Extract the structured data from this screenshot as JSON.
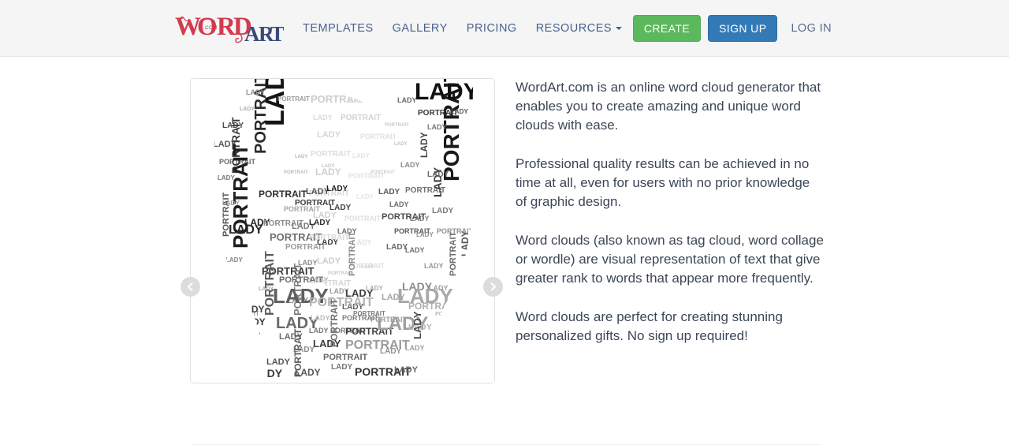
{
  "brand": {
    "word_text": "WORD",
    "com_text": ".COM",
    "art_text": "ART",
    "word_color": "#d23b4e",
    "art_color": "#3b4a7a"
  },
  "nav": {
    "items": [
      {
        "label": "TEMPLATES",
        "has_caret": false
      },
      {
        "label": "GALLERY",
        "has_caret": false
      },
      {
        "label": "PRICING",
        "has_caret": false
      },
      {
        "label": "RESOURCES",
        "has_caret": true
      }
    ]
  },
  "actions": {
    "create_label": "CREATE",
    "signup_label": "SIGN UP",
    "login_label": "LOG IN",
    "create_color": "#5cb85c",
    "signup_color": "#337ab7"
  },
  "carousel": {
    "prev_icon": "chevron-left-icon",
    "next_icon": "chevron-right-icon",
    "slide_alt": "Word cloud portrait of a face made from the words LADY and PORTRAIT",
    "cloud_words": [
      "LADY",
      "PORTRAIT"
    ]
  },
  "description": {
    "paragraphs": [
      "WordArt.com is an online word cloud generator that enables you to create amazing and unique word clouds with ease.",
      "Professional quality results can be achieved in no time at all, even for users with no prior knowledge of graphic design.",
      "Word clouds (also known as tag cloud, word collage or wordle) are visual representation of text that give greater rank to words that appear more frequently.",
      "Word clouds are perfect for creating stunning personalized gifts. No sign up required!"
    ]
  }
}
